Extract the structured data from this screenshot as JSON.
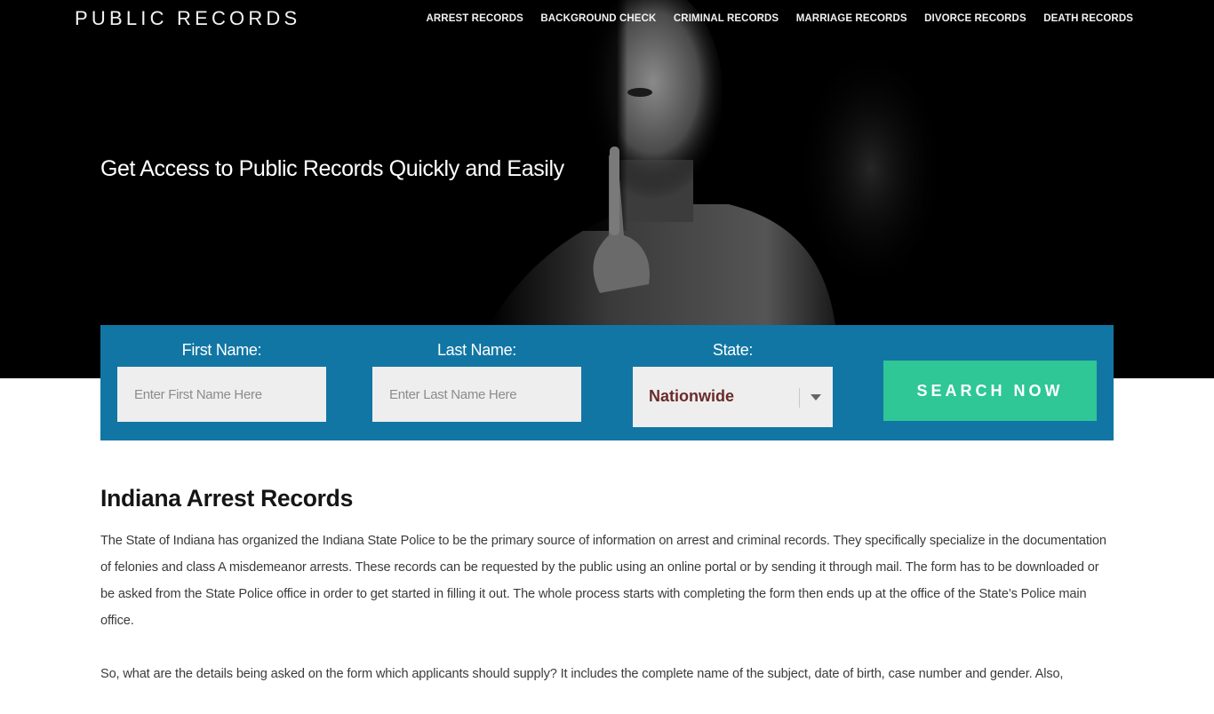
{
  "header": {
    "logo": "PUBLIC RECORDS",
    "nav": [
      {
        "label": "ARREST RECORDS"
      },
      {
        "label": "BACKGROUND CHECK"
      },
      {
        "label": "CRIMINAL RECORDS"
      },
      {
        "label": "MARRIAGE RECORDS"
      },
      {
        "label": "DIVORCE RECORDS"
      },
      {
        "label": "DEATH RECORDS"
      }
    ]
  },
  "hero": {
    "title": "Get Access to Public Records Quickly and Easily",
    "image": "man-shushing-photo"
  },
  "search": {
    "first_name": {
      "label": "First Name:",
      "placeholder": "Enter First Name Here",
      "value": ""
    },
    "last_name": {
      "label": "Last Name:",
      "placeholder": "Enter Last Name Here",
      "value": ""
    },
    "state": {
      "label": "State:",
      "selected": "Nationwide"
    },
    "button_label": "SEARCH NOW"
  },
  "colors": {
    "panel": "#1276a4",
    "button": "#2ec795",
    "state_text": "#6b2b2b"
  },
  "article": {
    "heading": "Indiana Arrest Records",
    "paragraphs": [
      "The State of Indiana has organized the Indiana State Police to be the primary source of information on arrest and criminal records. They specifically specialize in the documentation of felonies and class A misdemeanor arrests. These records can be requested by the public using an online portal or by sending it through mail. The form has to be downloaded or be asked from the State Police office in order to get started in filling it out. The whole process starts with completing the form then ends up at the office of the State’s Police main office.",
      "So, what are the details being asked on the form which applicants should supply? It includes the complete name of the subject, date of birth, case number and gender. Also,"
    ]
  }
}
